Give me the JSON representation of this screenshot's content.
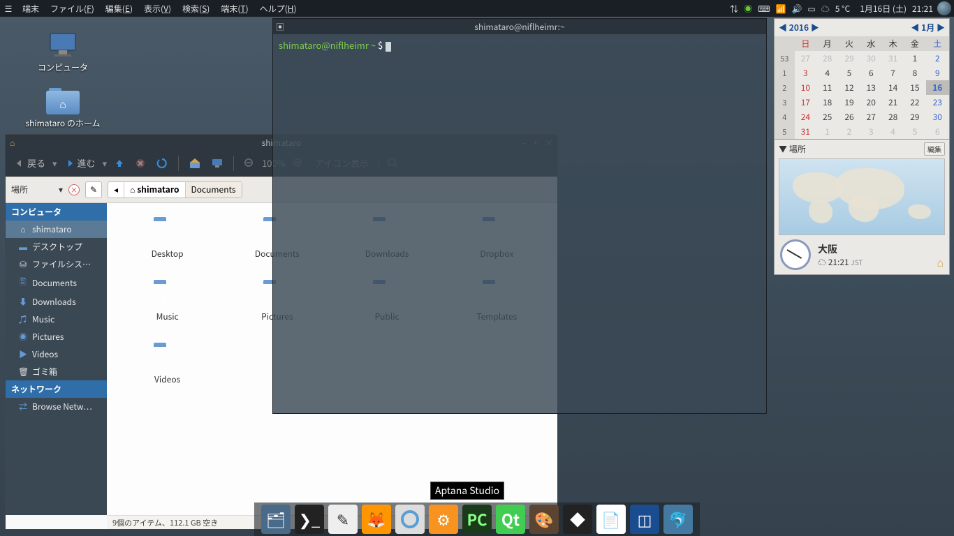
{
  "panel": {
    "app_name": "端末",
    "menu": [
      {
        "label": "ファイル",
        "key": "F"
      },
      {
        "label": "編集",
        "key": "E"
      },
      {
        "label": "表示",
        "key": "V"
      },
      {
        "label": "検索",
        "key": "S"
      },
      {
        "label": "端末",
        "key": "T"
      },
      {
        "label": "ヘルプ",
        "key": "H"
      }
    ],
    "weather": "5 °C",
    "date": "1月16日 (土)",
    "time": "21:21"
  },
  "desktop": {
    "icons": [
      {
        "name": "computer",
        "label": "コンピュータ"
      },
      {
        "name": "home",
        "label": "shimataro のホーム"
      }
    ]
  },
  "terminal": {
    "title": "shimataro@niflheimr:~",
    "prompt_user": "shimataro@niflheimr",
    "prompt_path": "~",
    "prompt_sym": "$"
  },
  "fm": {
    "title": "shimataro",
    "toolbar": {
      "back": "戻る",
      "forward": "進む",
      "zoom": "100%",
      "view": "アイコン表示"
    },
    "location": {
      "places": "場所",
      "crumb1": "shimataro",
      "crumb2": "Documents"
    },
    "sidebar": {
      "hdr1": "コンピュータ",
      "items1": [
        "shimataro",
        "デスクトップ",
        "ファイルシス…",
        "Documents",
        "Downloads",
        "Music",
        "Pictures",
        "Videos",
        "ゴミ箱"
      ],
      "hdr2": "ネットワーク",
      "items2": [
        "Browse Netw…"
      ]
    },
    "folders": [
      "Desktop",
      "Documents",
      "Downloads",
      "Dropbox",
      "Music",
      "Pictures",
      "Public",
      "Templates",
      "Videos"
    ],
    "folder_glyphs": [
      "",
      "",
      "⟳",
      "⇅",
      "♫",
      "◉",
      "<",
      "▤",
      ""
    ],
    "status": "9個のアイテム、112.1 GB 空き"
  },
  "calendar": {
    "year": "2016",
    "year_arrow_l": "◀",
    "year_arrow_r": "▶",
    "month": "1月",
    "month_arrow_l": "◀",
    "month_arrow_r": "▶",
    "dow": [
      "日",
      "月",
      "火",
      "水",
      "木",
      "金",
      "土"
    ],
    "weeks": [
      {
        "wk": "53",
        "d": [
          {
            "v": "27",
            "o": 1
          },
          {
            "v": "28",
            "o": 1
          },
          {
            "v": "29",
            "o": 1
          },
          {
            "v": "30",
            "o": 1
          },
          {
            "v": "31",
            "o": 1
          },
          {
            "v": "1"
          },
          {
            "v": "2"
          }
        ]
      },
      {
        "wk": "1",
        "d": [
          {
            "v": "3"
          },
          {
            "v": "4"
          },
          {
            "v": "5"
          },
          {
            "v": "6"
          },
          {
            "v": "7"
          },
          {
            "v": "8"
          },
          {
            "v": "9"
          }
        ]
      },
      {
        "wk": "2",
        "d": [
          {
            "v": "10"
          },
          {
            "v": "11"
          },
          {
            "v": "12"
          },
          {
            "v": "13"
          },
          {
            "v": "14"
          },
          {
            "v": "15"
          },
          {
            "v": "16",
            "t": 1
          }
        ]
      },
      {
        "wk": "3",
        "d": [
          {
            "v": "17"
          },
          {
            "v": "18"
          },
          {
            "v": "19"
          },
          {
            "v": "20"
          },
          {
            "v": "21"
          },
          {
            "v": "22"
          },
          {
            "v": "23"
          }
        ]
      },
      {
        "wk": "4",
        "d": [
          {
            "v": "24"
          },
          {
            "v": "25"
          },
          {
            "v": "26"
          },
          {
            "v": "27"
          },
          {
            "v": "28"
          },
          {
            "v": "29"
          },
          {
            "v": "30"
          }
        ]
      },
      {
        "wk": "5",
        "d": [
          {
            "v": "31"
          },
          {
            "v": "1",
            "o": 1
          },
          {
            "v": "2",
            "o": 1
          },
          {
            "v": "3",
            "o": 1
          },
          {
            "v": "4",
            "o": 1
          },
          {
            "v": "5",
            "o": 1
          },
          {
            "v": "6",
            "o": 1
          }
        ]
      }
    ]
  },
  "loc": {
    "hdr": "場所",
    "edit": "編集",
    "city": "大阪",
    "time": "21:21",
    "tz": "JST"
  },
  "dock": {
    "apps": [
      "files",
      "terminal",
      "editor",
      "firefox",
      "chromium",
      "aptana",
      "pycharm",
      "qt",
      "gimp",
      "inkscape",
      "libreoffice",
      "virtualbox",
      "mysql"
    ],
    "tooltip": "Aptana Studio"
  }
}
